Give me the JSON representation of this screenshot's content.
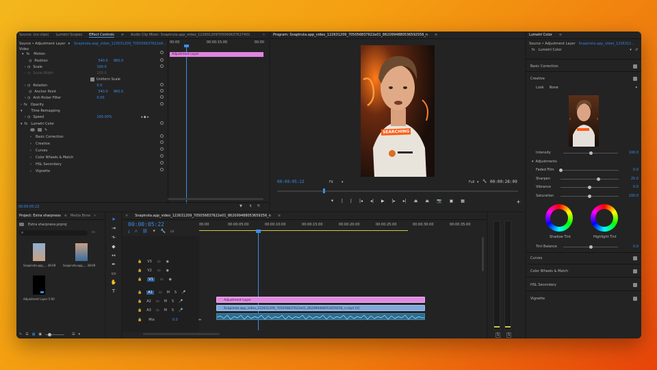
{
  "effect_controls": {
    "tabs": [
      "Source: (no clips)",
      "Lumetri Scopes",
      "Effect Controls",
      "Audio Clip Mixer: Snaptruta.app_video_1226012097050606376274017_8625989880536592556_n..."
    ],
    "active_tab": "Effect Controls",
    "source_label": "Source • Adjustment Layer",
    "sequence_label": "Snapinsta.app_video_122631209_705056837622e8...",
    "timecode_start": "00:00",
    "timecode_mid": "00:00:15:00",
    "timecode_end": "00:00",
    "clip_label": "Adjustment Layer",
    "section_video": "Video",
    "section_motion": "Motion",
    "position_label": "Position",
    "position_x": "540.0",
    "position_y": "960.0",
    "scale_label": "Scale",
    "scale_value": "100.0",
    "scale_width_label": "Scale Width",
    "scale_width_value": "100.0",
    "uniform_scale_label": "Uniform Scale",
    "rotation_label": "Rotation",
    "rotation_value": "0.0",
    "anchor_label": "Anchor Point",
    "anchor_x": "540.0",
    "anchor_y": "960.0",
    "antiflicker_label": "Anti-flicker Filter",
    "antiflicker_value": "0.00",
    "opacity_label": "Opacity",
    "time_remap_label": "Time Remapping",
    "speed_label": "Speed",
    "speed_value": "100.00%",
    "lumetri_label": "Lumetri Color",
    "lumetri_items": [
      "Basic Correction",
      "Creative",
      "Curves",
      "Color Wheels & Match",
      "HSL Secondary",
      "Vignette"
    ],
    "bottom_timecode": "00:00:05:22"
  },
  "program": {
    "title": "Program: Snaptruta.app_video_122631209_705056837622e01_8620994880536592556_n",
    "timecode_left": "00:00:05:22",
    "fit": "Fit",
    "quality": "Full",
    "timecode_right": "00:00:28:09",
    "caption": "SEARCHING"
  },
  "project": {
    "tabs": [
      "Project: Extra sharpness",
      "Media Brow"
    ],
    "project_file": "Extra sharpness.prproj",
    "items": [
      {
        "name": "Snapinsta.app_...",
        "duration": "26:09"
      },
      {
        "name": "Snapinsta.app_...",
        "duration": "28:09"
      },
      {
        "name": "Adjustment Layer",
        "duration": "5:00"
      }
    ]
  },
  "timeline": {
    "tab": "Snapinsta.app_video_122631209_705056837622e01_862099488053659256_n",
    "timecode": "00:00:05:22",
    "ruler": [
      "00:00",
      "00:00:05:00",
      "00:00:10:00",
      "00:00:15:00",
      "00:00:20:00",
      "00:00:25:00",
      "00:00:30:00",
      "00:00:35:00"
    ],
    "video_tracks": [
      "V3",
      "V2",
      "V1"
    ],
    "audio_tracks": [
      "A1",
      "A2",
      "A3"
    ],
    "mix_label": "Mix",
    "mix_value": "0.0",
    "adjustment_clip": "Adjustment Layer",
    "video_clip": "Snapinsta.app_video_122631209_705056837622e01_862099488053659256_n.mp4 [V]",
    "meter_left": "S",
    "meter_right": "S"
  },
  "lumetri": {
    "title": "Lumetri Color",
    "source_label": "Source • Adjustment Layer",
    "sequence_label": "Snapinsta.app_video_1226312...",
    "panel_name": "Lumetri Color",
    "basic_correction": "Basic Correction",
    "creative": "Creative",
    "look_label": "Look",
    "look_value": "None",
    "intensity_label": "Intensity",
    "intensity_value": "100.0",
    "adjustments_label": "Adjustments",
    "faded_label": "Faded Film",
    "faded_value": "0.0",
    "sharpen_label": "Sharpen",
    "sharpen_value": "25.0",
    "vibrance_label": "Vibrance",
    "vibrance_value": "0.0",
    "saturation_label": "Saturation",
    "saturation_value": "100.0",
    "shadow_tint": "Shadow Tint",
    "highlight_tint": "Highlight Tint",
    "tint_balance_label": "Tint Balance",
    "tint_balance_value": "0.0",
    "sections": [
      "Curves",
      "Color Wheels & Match",
      "HSL Secondary",
      "Vignette"
    ]
  }
}
